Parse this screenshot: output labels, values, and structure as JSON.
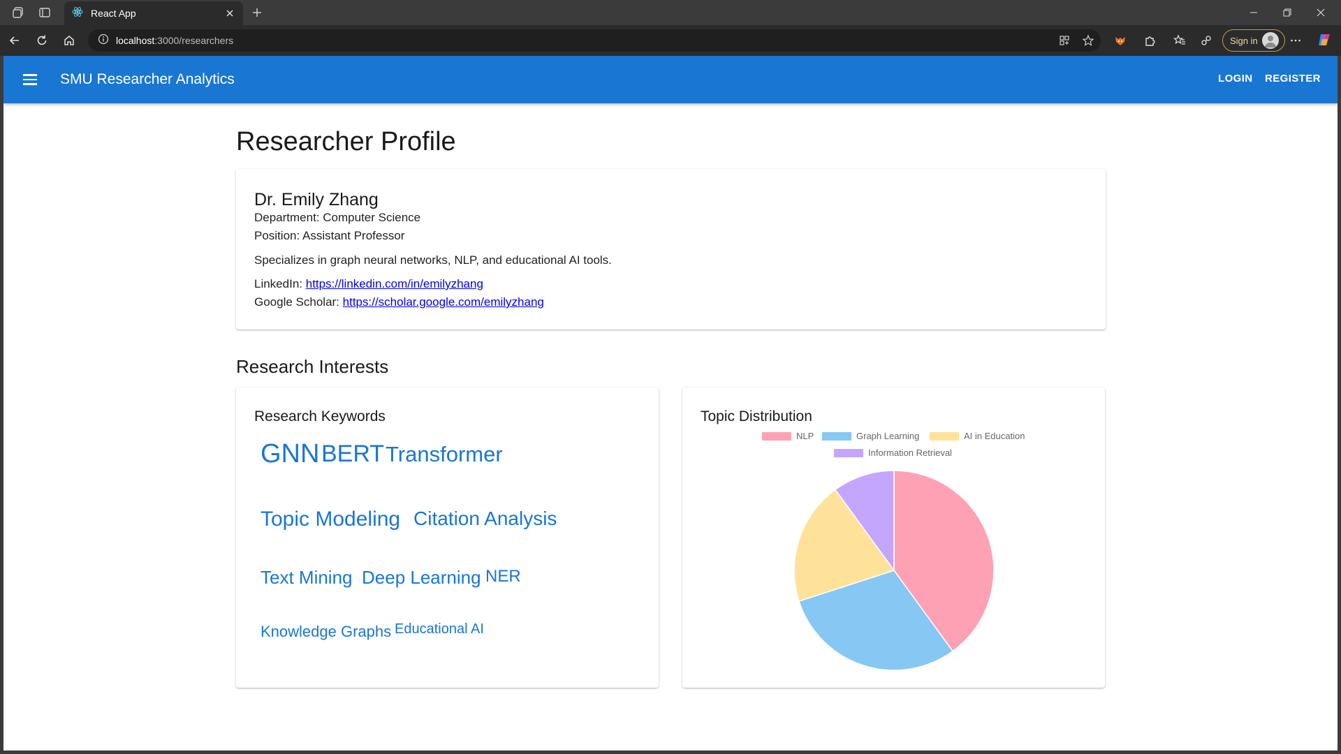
{
  "browser": {
    "tab_title": "React App",
    "url_host": "localhost",
    "url_path": ":3000/researchers",
    "sign_in_label": "Sign in"
  },
  "app": {
    "title": "SMU Researcher Analytics",
    "login_label": "LOGIN",
    "register_label": "REGISTER",
    "primary_color": "#1976d2"
  },
  "page": {
    "title": "Researcher Profile"
  },
  "profile": {
    "name": "Dr. Emily Zhang",
    "department_label": "Department:",
    "department": "Computer Science",
    "position_label": "Position:",
    "position": "Assistant Professor",
    "bio": "Specializes in graph neural networks, NLP, and educational AI tools.",
    "linkedin_label": "LinkedIn:",
    "linkedin_url": "https://linkedin.com/in/emilyzhang",
    "scholar_label": "Google Scholar:",
    "scholar_url": "https://scholar.google.com/emilyzhang"
  },
  "interests": {
    "section_title": "Research Interests",
    "keywords_title": "Research Keywords",
    "keywords": [
      "GNN",
      "BERT",
      "Transformer",
      "Topic Modeling",
      "Citation Analysis",
      "Text Mining",
      "Deep Learning",
      "NER",
      "Knowledge Graphs",
      "Educational AI"
    ]
  },
  "distribution": {
    "title": "Topic Distribution"
  },
  "chart_data": {
    "type": "pie",
    "title": "",
    "categories": [
      "NLP",
      "Graph Learning",
      "AI in Education",
      "Information Retrieval"
    ],
    "values": [
      40,
      30,
      20,
      10
    ],
    "colors": [
      "#ffa1b5",
      "#86c7f3",
      "#ffe29a",
      "#c4a6ff"
    ],
    "legend": "top"
  }
}
